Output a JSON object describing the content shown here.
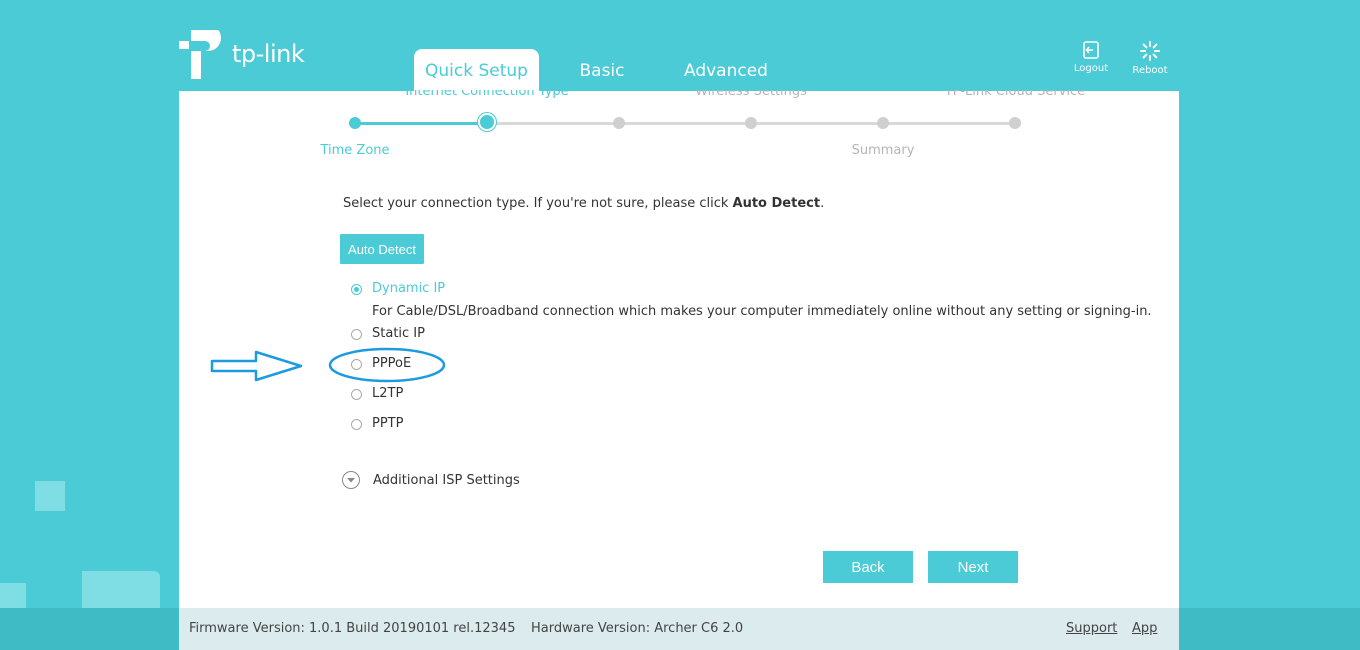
{
  "brand": {
    "logo_text": "tp-link"
  },
  "tabs": [
    {
      "label": "Quick Setup",
      "active": true
    },
    {
      "label": "Basic",
      "active": false
    },
    {
      "label": "Advanced",
      "active": false
    }
  ],
  "top_actions": {
    "logout_label": "Logout",
    "reboot_label": "Reboot"
  },
  "wizard": {
    "steps": [
      {
        "label": "Time Zone",
        "state": "done"
      },
      {
        "label": "Internet Connection Type",
        "state": "current"
      },
      {
        "label": "",
        "state": "todo"
      },
      {
        "label": "Wireless Settings",
        "state": "todo"
      },
      {
        "label": "Summary",
        "state": "todo"
      },
      {
        "label": "TP-Link Cloud Service",
        "state": "todo"
      }
    ]
  },
  "content": {
    "intro_text": "Select your connection type. If you're not sure, please click ",
    "intro_bold": "Auto Detect",
    "intro_end": ".",
    "auto_detect_label": "Auto Detect",
    "connection_types": [
      {
        "label": "Dynamic IP",
        "selected": true
      },
      {
        "label": "Static IP",
        "selected": false
      },
      {
        "label": "PPPoE",
        "selected": false
      },
      {
        "label": "L2TP",
        "selected": false
      },
      {
        "label": "PPTP",
        "selected": false
      }
    ],
    "dynamic_ip_description": "For Cable/DSL/Broadband connection which makes your computer immediately online without any setting or signing-in.",
    "additional_isp_label": "Additional ISP Settings",
    "back_label": "Back",
    "next_label": "Next"
  },
  "footer": {
    "firmware": "Firmware Version: 1.0.1 Build 20190101 rel.12345",
    "hardware": "Hardware Version: Archer C6 2.0",
    "support_label": "Support",
    "app_label": "App"
  },
  "colors": {
    "accent": "#4acbd6",
    "annotation": "#1e9be0"
  }
}
